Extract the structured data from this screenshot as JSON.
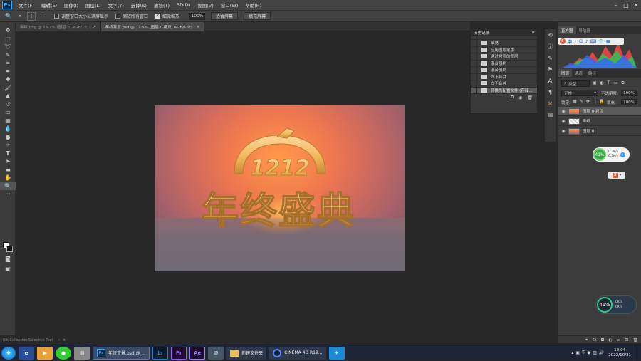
{
  "menubar": {
    "app_logo": "Ps",
    "items": [
      "文件(F)",
      "编辑(E)",
      "图像(I)",
      "图层(L)",
      "文字(Y)",
      "选择(S)",
      "滤镜(T)",
      "3D(D)",
      "视图(V)",
      "窗口(W)",
      "帮助(H)"
    ]
  },
  "options_bar": {
    "resize_windows_label": "调整窗口大小以满屏显示",
    "resize_windows_checked": false,
    "zoom_all_label": "缩放所有窗口",
    "zoom_all_checked": false,
    "scrubby_zoom_label": "细微缩放",
    "scrubby_zoom_checked": true,
    "zoom_value": "100%",
    "fit_screen_label": "适合屏幕",
    "fill_screen_label": "填充屏幕"
  },
  "doc_tabs": [
    {
      "label": "年终.png @ 16.7% (图层 0, RGB/16)",
      "active": false
    },
    {
      "label": "年终背景.psd @ 12.5% (图层 0 拷贝, RGB/16*)",
      "active": true
    }
  ],
  "artwork": {
    "number_text": "1212",
    "headline_text": "年终盛典"
  },
  "history_panel": {
    "title": "历史记录",
    "items": [
      "填充",
      "应用图层蒙版",
      "通过拷贝的图层",
      "混合器刷",
      "混合器刷",
      "向下合并",
      "向下合并",
      "转换为配置文件 (存储..."
    ]
  },
  "right_panel": {
    "top_tabs": [
      "直方图",
      "导航器"
    ],
    "layer_tabs": [
      "图层",
      "通道",
      "路径"
    ],
    "filter_label": "类型",
    "blend_mode": "正常",
    "opacity_label": "不透明度:",
    "opacity_value": "100%",
    "lock_label": "锁定:",
    "fill_label": "填充:",
    "fill_value": "100%",
    "layers": [
      "图层 0 拷贝",
      "年终",
      "图层 0"
    ]
  },
  "widgets": {
    "net_percent_1": "41%",
    "speed_up_1": "0.3K/s",
    "speed_down_1": "0.3K/s",
    "net_percent_2": "41%",
    "speed_up_2": "0K/s",
    "speed_down_2": "0K/s"
  },
  "statusbar": {
    "text": "Nik Collection Selective Tool"
  },
  "taskbar": {
    "apps": [
      "年终背景.psd @ ...",
      "新建文件夹",
      "CINEMA 4D R19..."
    ],
    "icons": [
      "Lr",
      "Pr",
      "Ae"
    ],
    "time": "18:04",
    "date": "2022/10/31"
  },
  "colors": {
    "ps_blue": "#31a8ff",
    "lr_blue": "#2b7ec9",
    "pr_purple": "#9b59ff",
    "ae_purple": "#a07bff",
    "gold": "#f2b95b"
  }
}
